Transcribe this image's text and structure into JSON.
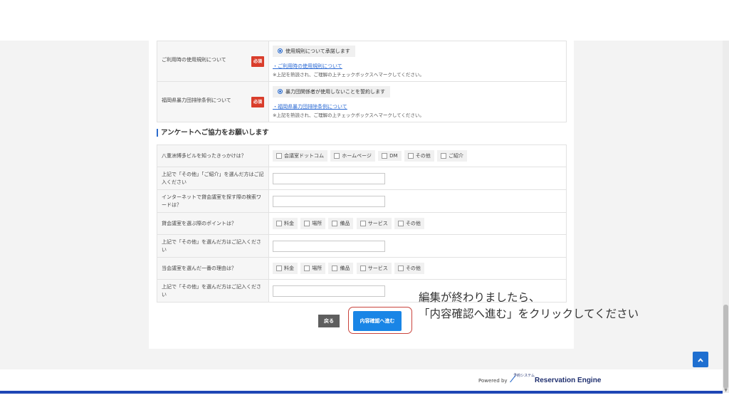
{
  "terms": [
    {
      "label": "ご利用時の使用規則について",
      "required": "必須",
      "radio_label": "使用規則について承諾します",
      "link": "・ご利用時の使用規則について",
      "note": "※上記を熟読され、ご理解の上チェックボックスへマークしてください。"
    },
    {
      "label": "福岡県暴力団排除条例について",
      "required": "必須",
      "radio_label": "暴力団関係者が使用しないことを誓約します",
      "link": "・福岡県暴力団排除条例について",
      "note": "※上記を熟読され、ご理解の上チェックボックスへマークしてください。"
    }
  ],
  "survey": {
    "title": "アンケートへご協力をお願いします",
    "rows": [
      {
        "label": "八重洲博多ビルを知ったきっかけは？",
        "options": [
          "会議室ドットコム",
          "ホームページ",
          "DM",
          "その他",
          "ご紹介"
        ]
      },
      {
        "label": "上記で「その他」「ご紹介」を選んだ方はご記入ください"
      },
      {
        "label": "インターネットで貸会議室を探す際の検索ワードは？"
      },
      {
        "label": "貸会議室を選ぶ際のポイントは？",
        "options": [
          "料金",
          "場所",
          "備品",
          "サービス",
          "その他"
        ]
      },
      {
        "label": "上記で「その他」を選んだ方はご記入ください"
      },
      {
        "label": "当会議室を選んだ一番の理由は？",
        "options": [
          "料金",
          "場所",
          "備品",
          "サービス",
          "その他"
        ]
      },
      {
        "label": "上記で「その他」を選んだ方はご記入ください"
      }
    ]
  },
  "buttons": {
    "back": "戻る",
    "confirm": "内容確認へ進む"
  },
  "instruction": {
    "line1": "編集が終わりましたら、",
    "line2": "「内容確認へ進む」をクリックしてください"
  },
  "footer": {
    "powered_by": "Powered by",
    "logo_small": "予約システム",
    "logo_text": "Reservation Engine"
  },
  "scroll_top_icon": "chevron-up-icon",
  "colors": {
    "accent": "#1985e6",
    "required": "#d93d2b",
    "bar": "#1e46b5"
  }
}
